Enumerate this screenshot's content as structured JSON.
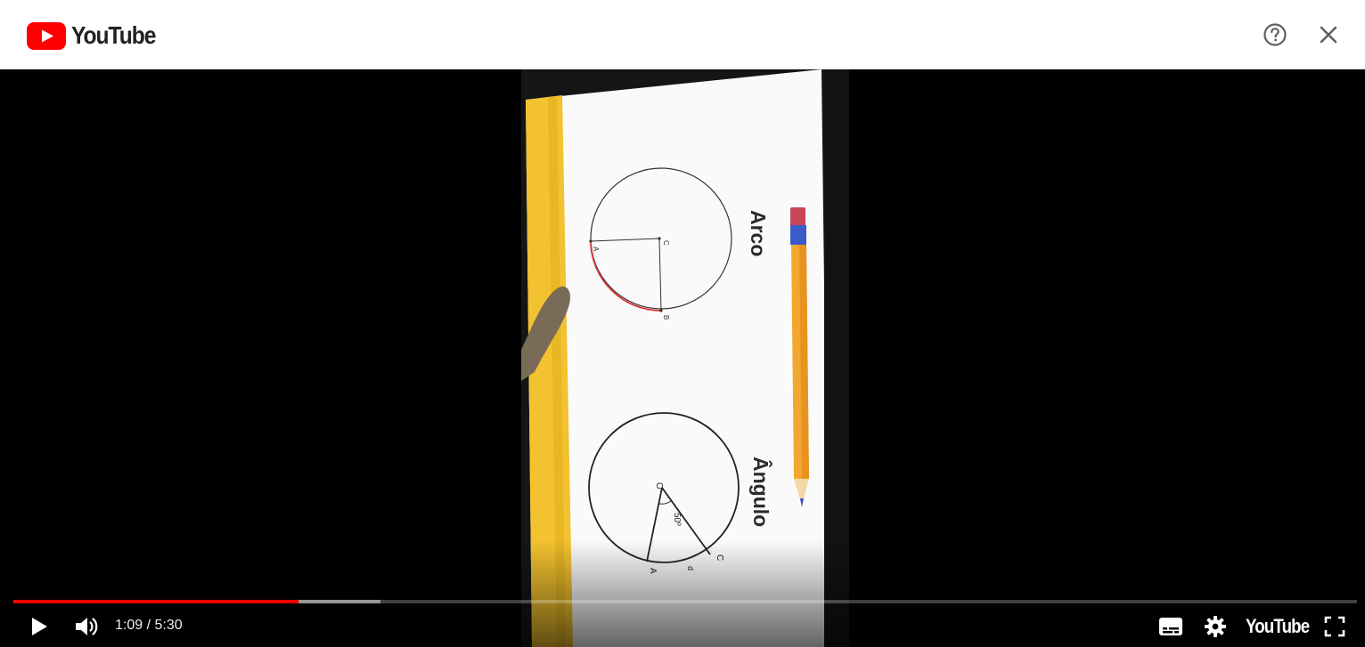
{
  "header": {
    "brand": "YouTube",
    "help_icon": "help-circle-icon",
    "close_icon": "close-icon"
  },
  "video": {
    "slide": {
      "title_top": "Arco",
      "title_bottom": "Ângulo",
      "circle1_labels": [
        "A",
        "B",
        "C"
      ],
      "circle2_labels": [
        "O",
        "A",
        "C",
        "d",
        "50º"
      ]
    }
  },
  "controls": {
    "current_time": "1:09",
    "duration": "5:30",
    "time_display": "1:09 / 5:30",
    "played_fraction": 0.2124,
    "buffered_fraction": 0.2734,
    "brand": "YouTube",
    "icons": [
      "play-icon",
      "volume-icon",
      "subtitles-icon",
      "settings-icon",
      "youtube-logo",
      "fullscreen-icon"
    ]
  },
  "colors": {
    "brand_red": "#FF0000",
    "progress_played": "#FF0000",
    "slide_yellow": "#F2C230"
  }
}
